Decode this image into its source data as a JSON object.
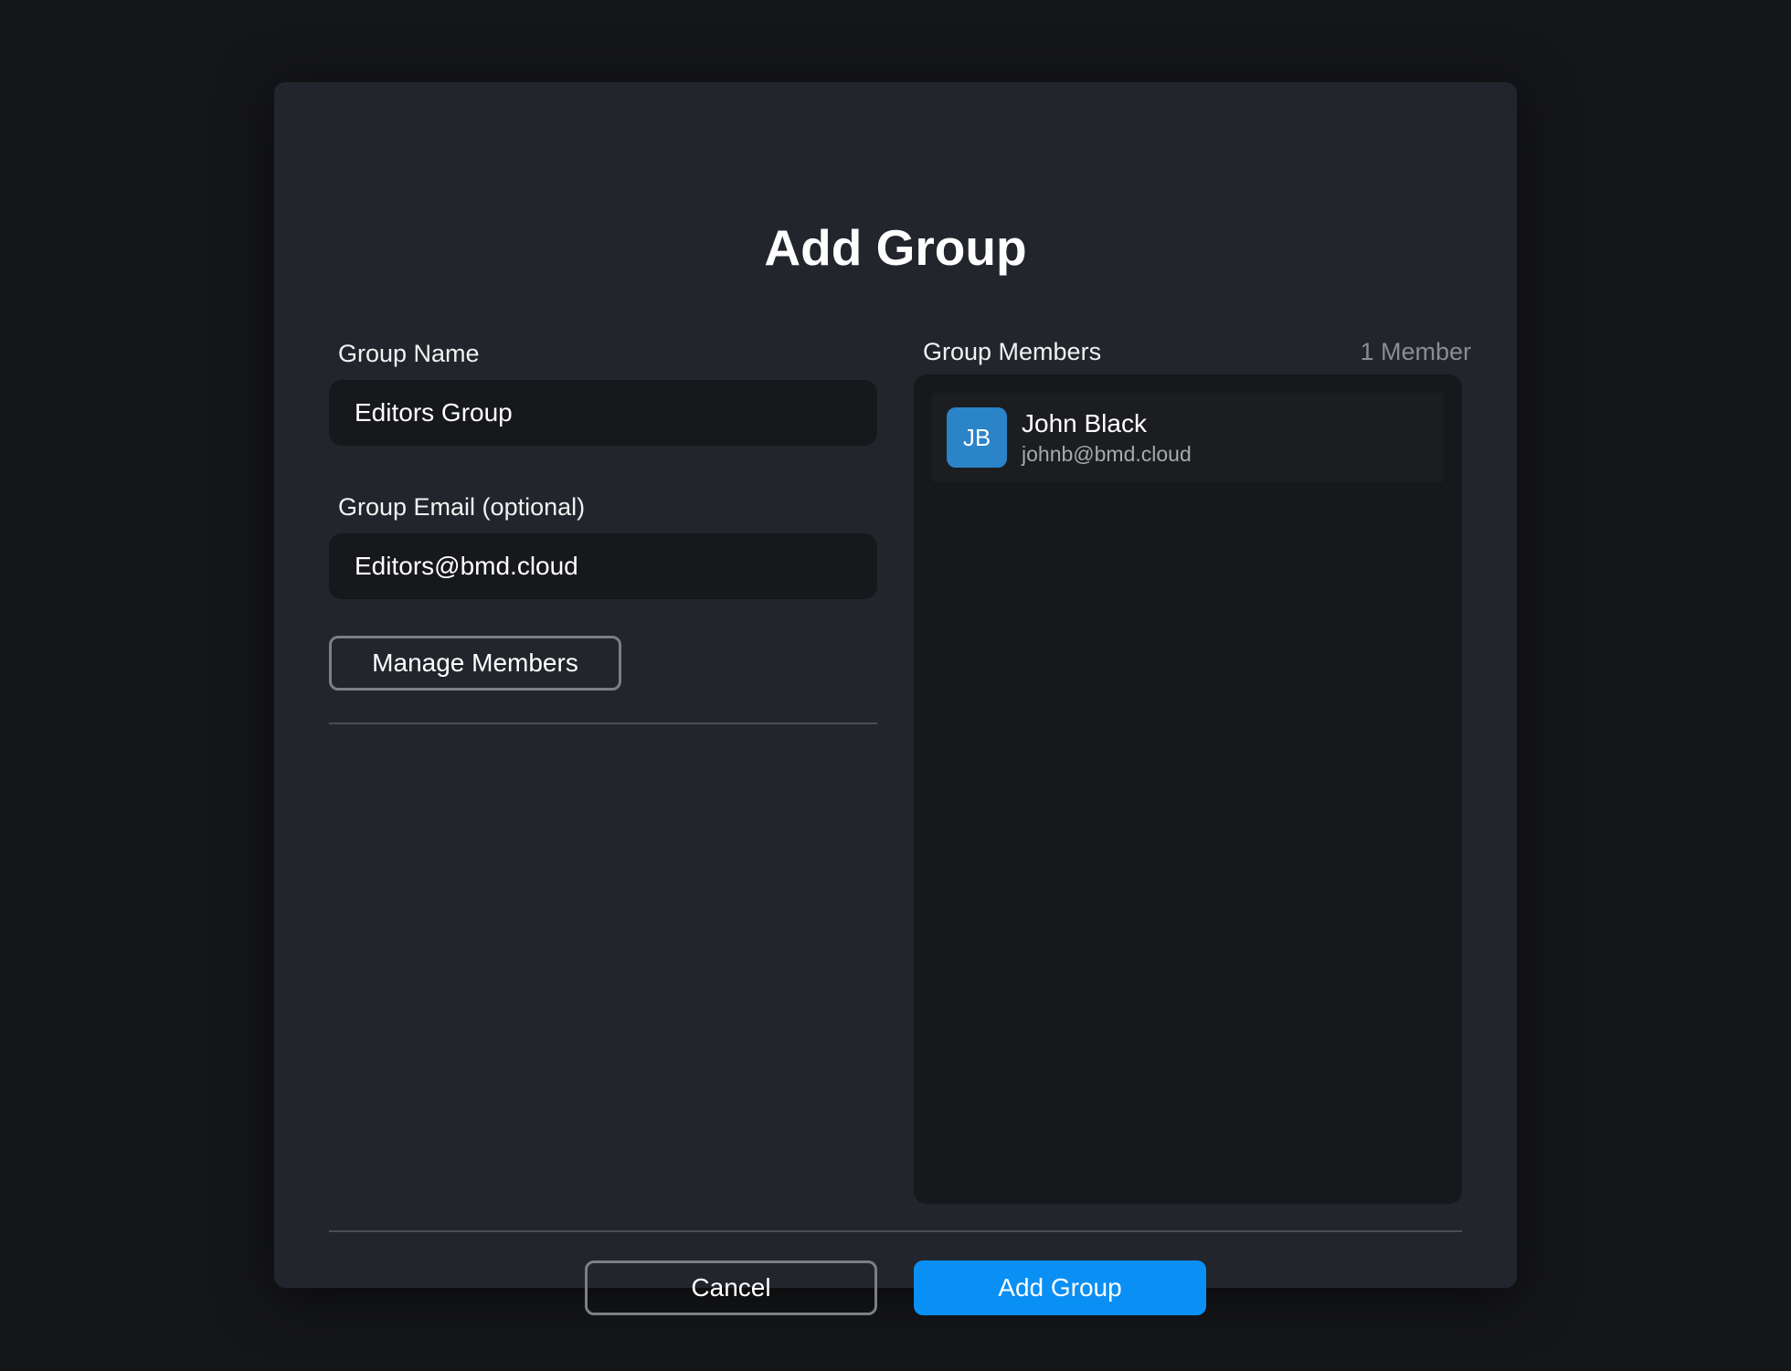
{
  "dialog": {
    "title": "Add Group"
  },
  "form": {
    "group_name": {
      "label": "Group Name",
      "value": "Editors Group"
    },
    "group_email": {
      "label": "Group Email (optional)",
      "value": "Editors@bmd.cloud"
    },
    "manage_members_label": "Manage Members"
  },
  "members": {
    "title": "Group Members",
    "count_label": "1 Member",
    "items": [
      {
        "initials": "JB",
        "name": "John Black",
        "email": "johnb@bmd.cloud",
        "avatar_color": "#2b83c8"
      }
    ]
  },
  "footer": {
    "cancel_label": "Cancel",
    "submit_label": "Add Group"
  },
  "colors": {
    "backdrop": "#151619",
    "dialog": "#22252b",
    "input": "#17181b",
    "accent": "#0a8ff5"
  }
}
